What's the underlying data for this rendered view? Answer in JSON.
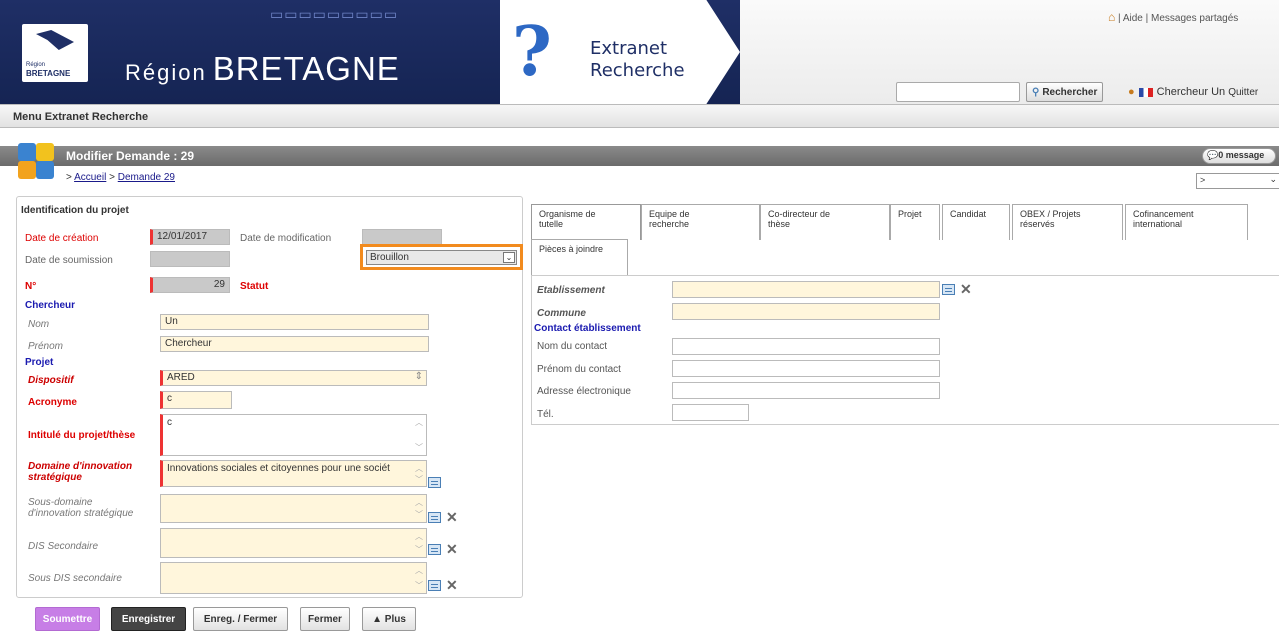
{
  "header": {
    "region_small": "Région",
    "region_logo_text": "BRETAGNE",
    "brand_prefix": "Région",
    "brand_name": "BRETAGNE",
    "app_line1": "Extranet",
    "app_line2": "Recherche",
    "top_links": "| Aide | Messages partagés",
    "search_button": "Rechercher",
    "user_name": "Chercheur Un",
    "user_action": "Quitter"
  },
  "menu": {
    "label": "Menu Extranet Recherche"
  },
  "page": {
    "title": "Modifier Demande : 29",
    "breadcrumb_sep": ">",
    "breadcrumb_home": "Accueil",
    "breadcrumb_sep2": ">",
    "breadcrumb_current": "Demande 29",
    "messages": "0 message",
    "nav_select": ">"
  },
  "left": {
    "section_title": "Identification du projet",
    "date_creation_label": "Date de création",
    "date_creation_value": "12/01/2017",
    "date_modif_label": "Date de modification",
    "date_modif_value": "",
    "date_soumission_label": "Date de soumission",
    "num_label": "N°",
    "num_value": "29",
    "statut_label": "Statut",
    "statut_value": "Brouillon",
    "chercheur_section": "Chercheur",
    "nom_label": "Nom",
    "nom_value": "Un",
    "prenom_label": "Prénom",
    "prenom_value": "Chercheur",
    "projet_section": "Projet",
    "dispositif_label": "Dispositif",
    "dispositif_value": "ARED",
    "acronyme_label": "Acronyme",
    "acronyme_value": "c",
    "intitule_label": "Intitulé du projet/thèse",
    "intitule_value": "c",
    "domaine_label_1": "Domaine d'innovation",
    "domaine_label_2": "stratégique",
    "domaine_value": "Innovations sociales et citoyennes pour une sociét",
    "sous_domaine_label_1": "Sous-domaine",
    "sous_domaine_label_2": "d'innovation stratégique",
    "dis_secondaire_label": "DIS Secondaire",
    "sous_dis_label": "Sous DIS secondaire"
  },
  "buttons": {
    "soumettre": "Soumettre",
    "enregistrer": "Enregistrer",
    "enreg_fermer": "Enreg. / Fermer",
    "fermer": "Fermer",
    "plus": "▲ Plus"
  },
  "tabs": [
    {
      "l1": "Organisme de",
      "l2": "tutelle"
    },
    {
      "l1": "Equipe de",
      "l2": "recherche"
    },
    {
      "l1": "Co-directeur de",
      "l2": "thèse"
    },
    {
      "l1": "Projet",
      "l2": ""
    },
    {
      "l1": "Candidat",
      "l2": ""
    },
    {
      "l1": "OBEX / Projets",
      "l2": "réservés"
    },
    {
      "l1": "Cofinancement",
      "l2": "international"
    },
    {
      "l1": "Pièces à joindre",
      "l2": ""
    }
  ],
  "right": {
    "etablissement_label": "Etablissement",
    "commune_label": "Commune",
    "contact_section": "Contact établissement",
    "nom_contact_label": "Nom du contact",
    "prenom_contact_label": "Prénom du contact",
    "email_label": "Adresse électronique",
    "tel_label": "Tél."
  },
  "colors": {
    "navy": "#1f2f66",
    "required": "#e33333",
    "highlight": "#f28b1e",
    "soumettre": "#c77ee6"
  }
}
